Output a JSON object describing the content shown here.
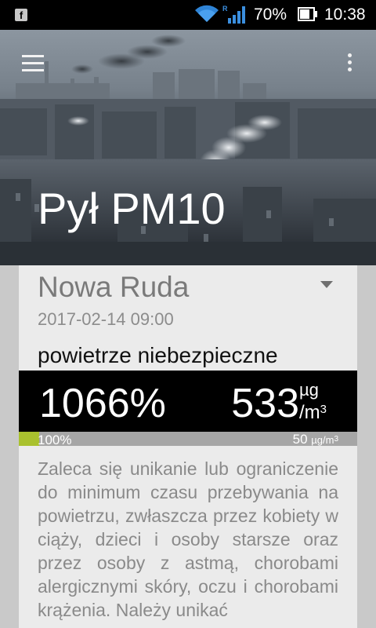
{
  "status_bar": {
    "app_icon": "f",
    "roaming": "R",
    "battery_percent": "70%",
    "time": "10:38"
  },
  "hero": {
    "title": "Pył PM10",
    "menu_icon": "hamburger-menu-icon",
    "overflow_icon": "more-vertical-icon"
  },
  "station": {
    "name": "Nowa Ruda",
    "date": "2017-02-14 09:00"
  },
  "quality": {
    "label": "powietrze niebezpieczne"
  },
  "reading": {
    "percent": "1066%",
    "value": "533",
    "unit_top": "µg",
    "unit_bottom": "/m",
    "unit_exp": "3"
  },
  "scale": {
    "label": "100%",
    "limit_value": "50",
    "limit_unit": "µg/m",
    "limit_exp": "3",
    "fill_fraction": 0.06
  },
  "advice": {
    "text": "Zaleca się unikanie lub ograniczenie do minimum czasu przebywania na powietrzu, zwłaszcza przez kobiety w ciąży, dzieci i osoby starsze oraz przez osoby z astmą, chorobami alergicznymi skóry, oczu i chorobami krążenia. Należy unikać"
  },
  "colors": {
    "status_bar": "#000000",
    "card_bg": "#ebebeb",
    "reading_bar": "#000000",
    "scale_fill": "#a9c12e",
    "scale_track": "#a6a6a6"
  }
}
